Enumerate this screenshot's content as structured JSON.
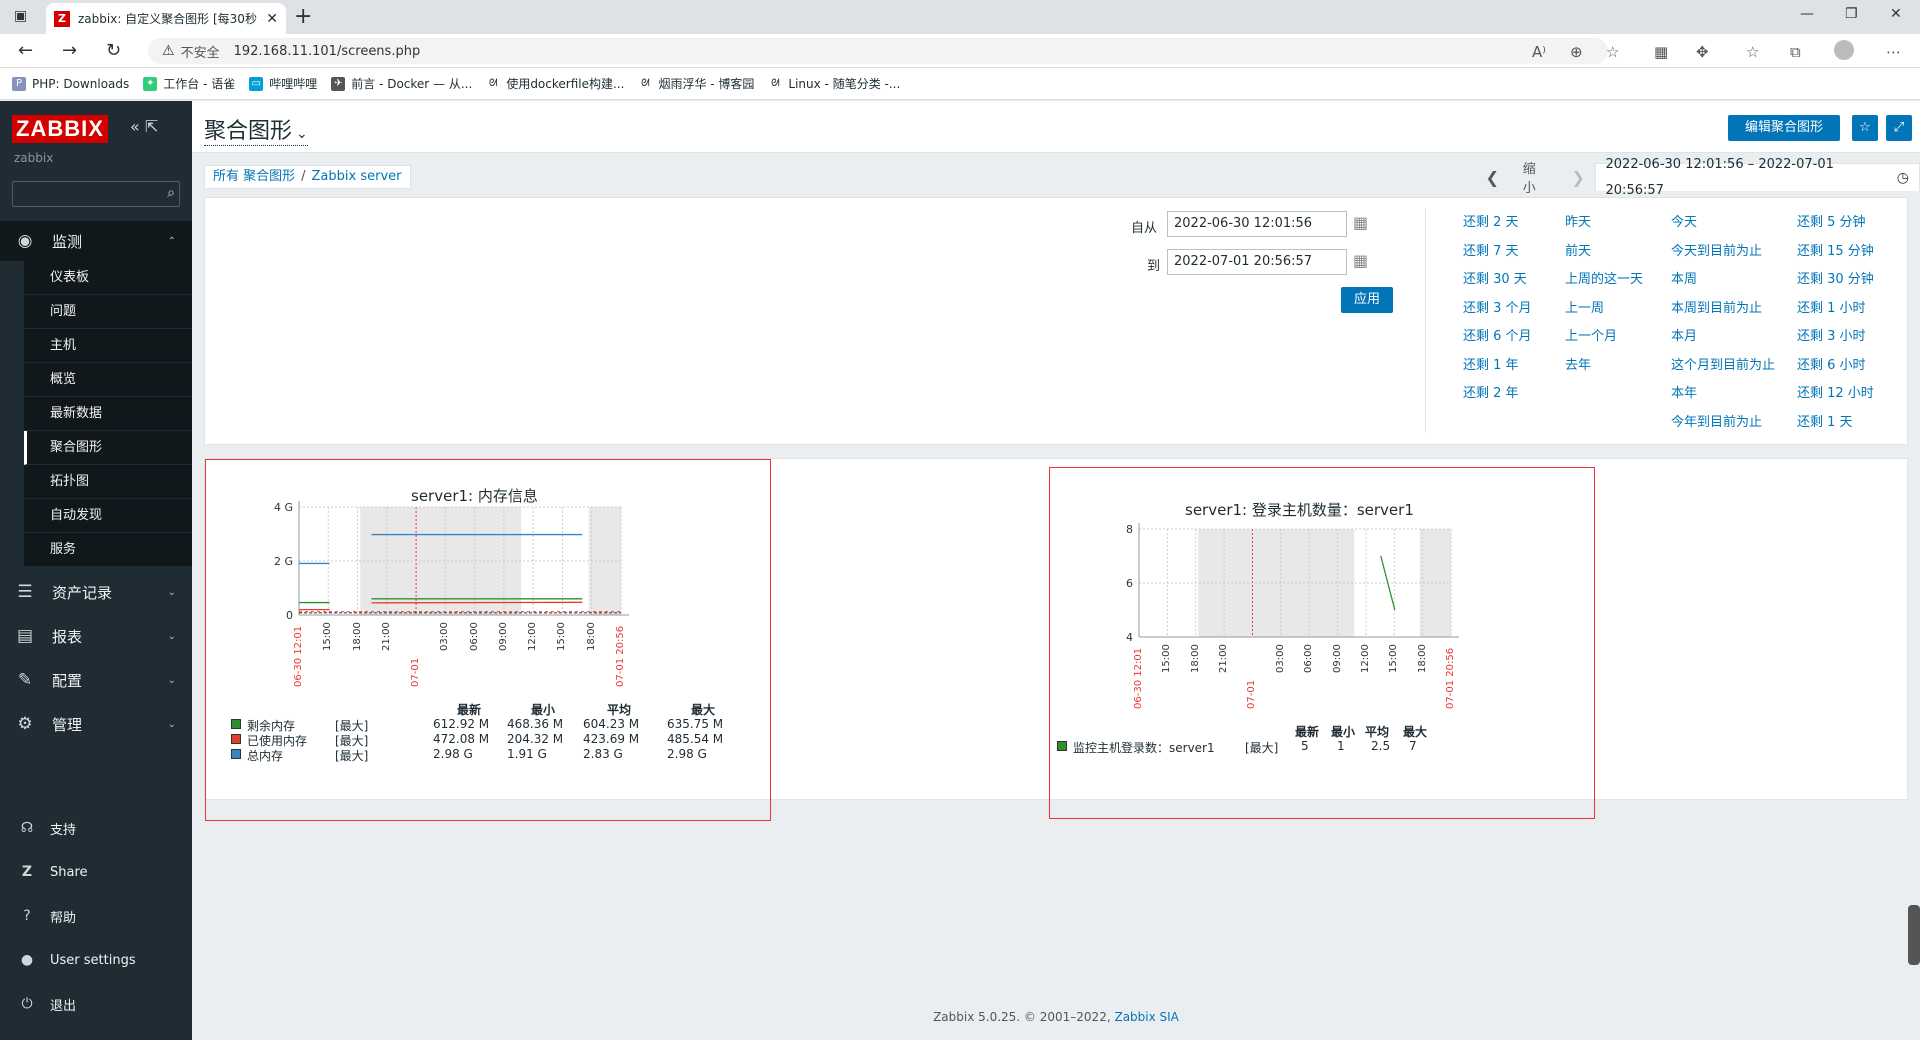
{
  "browser": {
    "tab_title": "zabbix: 自定义聚合图形 [每30秒",
    "favicon_letter": "Z",
    "insecure_label": "不安全",
    "url": "192.168.11.101/screens.php",
    "bookmarks": [
      {
        "label": "PHP: Downloads",
        "color": "#8892bf"
      },
      {
        "label": "工作台 - 语雀",
        "color": "#31cc79"
      },
      {
        "label": "哔哩哔哩",
        "color": "#00a1d6"
      },
      {
        "label": "前言 - Docker — 从...",
        "color": "#555555"
      },
      {
        "label": "使用dockerfile构建...",
        "color": "#555555"
      },
      {
        "label": "烟雨浮华 - 博客园",
        "color": "#555555"
      },
      {
        "label": "Linux - 随笔分类 -...",
        "color": "#555555"
      }
    ]
  },
  "sidebar": {
    "logo": "ZABBIX",
    "server_name": "zabbix",
    "monitoring": {
      "label": "监测",
      "icon": "eye-icon"
    },
    "submenu": [
      {
        "label": "仪表板"
      },
      {
        "label": "问题"
      },
      {
        "label": "主机"
      },
      {
        "label": "概览"
      },
      {
        "label": "最新数据"
      },
      {
        "label": "聚合图形",
        "active": true
      },
      {
        "label": "拓扑图"
      },
      {
        "label": "自动发现"
      },
      {
        "label": "服务"
      }
    ],
    "sections": [
      {
        "label": "资产记录",
        "icon": "list-icon"
      },
      {
        "label": "报表",
        "icon": "chart-icon"
      },
      {
        "label": "配置",
        "icon": "wrench-icon"
      },
      {
        "label": "管理",
        "icon": "gear-icon"
      }
    ],
    "footer": [
      {
        "label": "支持",
        "icon": "headset-icon"
      },
      {
        "label": "Share",
        "icon": "share-icon"
      },
      {
        "label": "帮助",
        "icon": "help-icon"
      },
      {
        "label": "User settings",
        "icon": "user-icon"
      },
      {
        "label": "退出",
        "icon": "power-icon"
      }
    ]
  },
  "header": {
    "title": "聚合图形",
    "edit_button": "编辑聚合图形"
  },
  "breadcrumb": {
    "all": "所有 聚合图形",
    "current": "Zabbix server"
  },
  "timenav": {
    "zoom_label": "缩小",
    "range": "2022-06-30 12:01:56 – 2022-07-01 20:56:57"
  },
  "filter": {
    "from_label": "自从",
    "from_value": "2022-06-30 12:01:56",
    "to_label": "到",
    "to_value": "2022-07-01 20:56:57",
    "apply": "应用",
    "quick": [
      [
        "还剩 2 天",
        "还剩 7 天",
        "还剩 30 天",
        "还剩 3 个月",
        "还剩 6 个月",
        "还剩 1 年",
        "还剩 2 年"
      ],
      [
        "昨天",
        "前天",
        "上周的这一天",
        "上一周",
        "上一个月",
        "去年"
      ],
      [
        "今天",
        "今天到目前为止",
        "本周",
        "本周到目前为止",
        "本月",
        "这个月到目前为止",
        "本年",
        "今年到目前为止"
      ],
      [
        "还剩 5 分钟",
        "还剩 15 分钟",
        "还剩 30 分钟",
        "还剩 1 小时",
        "还剩 3 小时",
        "还剩 6 小时",
        "还剩 12 小时",
        "还剩 1 天"
      ]
    ]
  },
  "graph1": {
    "title": "server1: 内存信息",
    "y_ticks": [
      "4 G",
      "2 G",
      "0"
    ],
    "x_ticks": [
      "06-30 12:01",
      "15:00",
      "18:00",
      "21:00",
      "07-01",
      "03:00",
      "06:00",
      "09:00",
      "12:00",
      "15:00",
      "18:00",
      "07-01 20:56"
    ],
    "legend_headers": [
      "最新",
      "最小",
      "平均",
      "最大"
    ],
    "legend": [
      {
        "name": "剩余内存",
        "func": "[最大]",
        "last": "612.92 M",
        "min": "468.36 M",
        "avg": "604.23 M",
        "max": "635.75 M",
        "color": "#2f8f2f"
      },
      {
        "name": "已使用内存",
        "func": "[最大]",
        "last": "472.08 M",
        "min": "204.32 M",
        "avg": "423.69 M",
        "max": "485.54 M",
        "color": "#e0402a"
      },
      {
        "name": "总内存",
        "func": "[最大]",
        "last": "2.98 G",
        "min": "1.91 G",
        "avg": "2.83 G",
        "max": "2.98 G",
        "color": "#3a84c4"
      }
    ]
  },
  "graph2": {
    "title": "server1: 登录主机数量：server1",
    "y_ticks": [
      "8",
      "6",
      "4"
    ],
    "x_ticks": [
      "06-30 12:01",
      "15:00",
      "18:00",
      "21:00",
      "07-01",
      "03:00",
      "06:00",
      "09:00",
      "12:00",
      "15:00",
      "18:00",
      "07-01 20:56"
    ],
    "legend_headers": [
      "最新",
      "最小",
      "平均",
      "最大"
    ],
    "legend": [
      {
        "name": "监控主机登录数：server1",
        "func": "[最大]",
        "last": "5",
        "min": "1",
        "avg": "2.5",
        "max": "7",
        "color": "#2f8f2f"
      }
    ]
  },
  "footer": {
    "text": "Zabbix 5.0.25. © 2001–2022,",
    "link": "Zabbix SIA"
  }
}
